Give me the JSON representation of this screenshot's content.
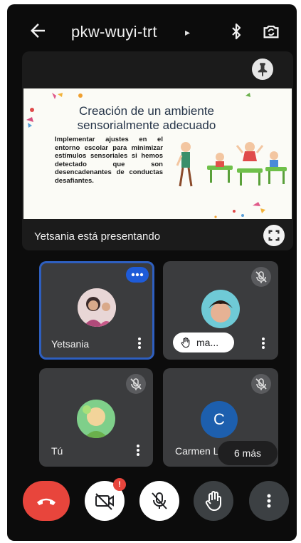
{
  "meeting": {
    "code": "pkw-wuyi-trt",
    "caret": "▸"
  },
  "topbar": {
    "back_icon": "arrow-left-icon",
    "bluetooth_icon": "bluetooth-icon",
    "switch_camera_icon": "switch-camera-icon"
  },
  "presentation": {
    "caption": "Yetsania está presentando",
    "slide": {
      "title_line1": "Creación de un ambiente",
      "title_line2": "sensorialmente adecuado",
      "body": "Implementar ajustes en el entorno escolar para minimizar estímulos sensoriales si hemos detectado que son desencadenantes de conductas desafiantes."
    }
  },
  "tiles": [
    {
      "name": "Yetsania",
      "state": "speaking"
    },
    {
      "name": "",
      "hand_label": "ma...",
      "state": "muted"
    },
    {
      "name": "Tú",
      "state": "muted"
    },
    {
      "name": "Carmen L",
      "initial": "C",
      "state": "muted"
    }
  ],
  "more_participants": "6 más",
  "controls": {
    "camera_badge": "!"
  },
  "colors": {
    "end_call": "#e8453c",
    "accent_blue": "#1e5bd8",
    "tile_bg": "#3b3c3e"
  }
}
